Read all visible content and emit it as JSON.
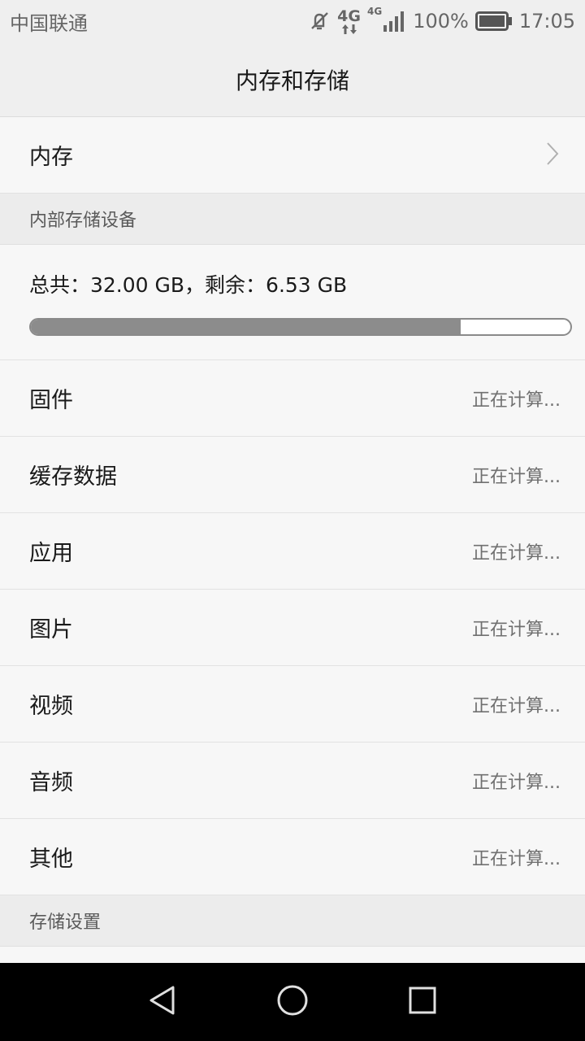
{
  "status_bar": {
    "carrier": "中国联通",
    "network_1": "4G",
    "network_2": "4G",
    "battery": "100%",
    "time": "17:05",
    "icons": [
      "mute-icon",
      "data-transfer-icon",
      "signal-icon",
      "battery-icon"
    ]
  },
  "toolbar": {
    "title": "内存和存储"
  },
  "memory_row": {
    "label": "内存",
    "icon": "chevron-right-icon"
  },
  "internal_storage": {
    "header": "内部存储设备",
    "summary": "总共：32.00 GB，剩余：6.53 GB",
    "used_fraction": 0.796
  },
  "categories": [
    {
      "label": "固件",
      "value": "正在计算..."
    },
    {
      "label": "缓存数据",
      "value": "正在计算..."
    },
    {
      "label": "应用",
      "value": "正在计算..."
    },
    {
      "label": "图片",
      "value": "正在计算..."
    },
    {
      "label": "视频",
      "value": "正在计算..."
    },
    {
      "label": "音频",
      "value": "正在计算..."
    },
    {
      "label": "其他",
      "value": "正在计算..."
    }
  ],
  "storage_settings": {
    "header": "存储设置"
  },
  "nav_bar": {
    "icons": [
      "back-icon",
      "home-icon",
      "recents-icon"
    ]
  },
  "colors": {
    "progress_fill": "#8c8c8c",
    "background": "#f7f7f7",
    "section_header": "#ececec"
  }
}
